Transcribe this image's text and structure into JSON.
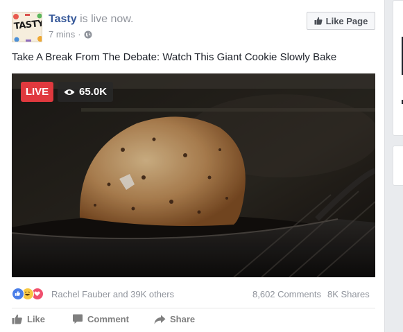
{
  "post": {
    "author": "Tasty",
    "status": "is live now.",
    "time": "7 mins",
    "separator": "·",
    "privacy_icon": "globe-icon",
    "like_page_label": "Like Page",
    "like_page_icon": "thumbs-up-icon",
    "avatar_text": "TASTY",
    "text": "Take A Break From The Debate: Watch This Giant Cookie Slowly Bake"
  },
  "video": {
    "live_label": "LIVE",
    "viewers": "65.0K",
    "viewer_icon": "eye-icon"
  },
  "engagement": {
    "reaction_icons": [
      "like-reaction-icon",
      "haha-reaction-icon",
      "love-reaction-icon"
    ],
    "reactors": "Rachel Fauber and 39K others",
    "comments": "8,602 Comments",
    "shares": "8K Shares"
  },
  "actions": {
    "like": "Like",
    "comment": "Comment",
    "share": "Share"
  },
  "colors": {
    "link": "#365899",
    "live": "#e0393e",
    "like_reaction": "#4a7ee8",
    "haha_reaction": "#f7c843",
    "love_reaction": "#f0506e"
  }
}
